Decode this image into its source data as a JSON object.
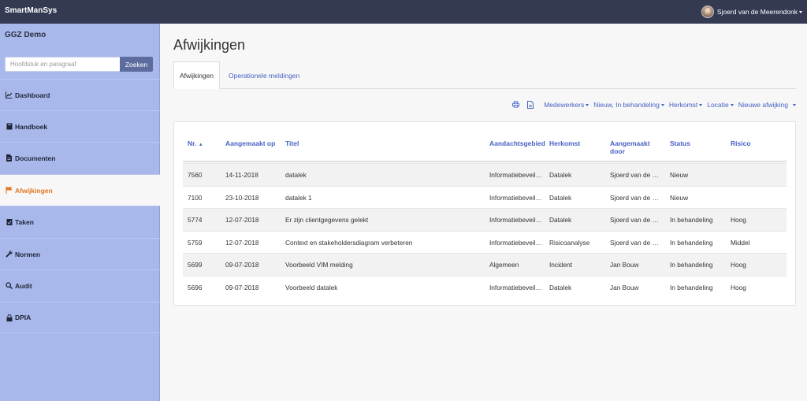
{
  "app": {
    "brand": "SmartManSys",
    "user_name": "Sjoerd van de Meerendonk"
  },
  "sidebar": {
    "org": "GGZ Demo",
    "search_placeholder": "Hoofdstuk en paragraaf",
    "search_button": "Zoeken",
    "items": [
      {
        "label": "Dashboard",
        "icon": "chart-line-icon"
      },
      {
        "label": "Handboek",
        "icon": "book-icon"
      },
      {
        "label": "Documenten",
        "icon": "file-icon"
      },
      {
        "label": "Afwijkingen",
        "icon": "flag-icon",
        "active": true
      },
      {
        "label": "Taken",
        "icon": "calendar-check-icon"
      },
      {
        "label": "Normen",
        "icon": "wrench-icon"
      },
      {
        "label": "Audit",
        "icon": "search-icon"
      },
      {
        "label": "DPIA",
        "icon": "lock-icon"
      }
    ]
  },
  "main": {
    "title": "Afwijkingen",
    "tabs": [
      {
        "label": "Afwijkingen",
        "active": true
      },
      {
        "label": "Operationele meldingen"
      }
    ],
    "toolbar": {
      "filters": [
        "Medewerkers",
        "Nieuw, In behandeling",
        "Herkomst",
        "Locatie"
      ],
      "new_label": "Nieuwe afwijking"
    }
  },
  "table": {
    "headers": [
      "Nr.",
      "Aangemaakt op",
      "Titel",
      "Aandachtsgebied",
      "Herkomst",
      "Aangemaakt door",
      "Status",
      "Risico"
    ],
    "rows": [
      [
        "7560",
        "14-11-2018",
        "datalek",
        "Informatiebeveil…",
        "Datalek",
        "Sjoerd van de …",
        "Nieuw",
        ""
      ],
      [
        "7100",
        "23-10-2018",
        "datalek 1",
        "Informatiebeveil…",
        "Datalek",
        "Sjoerd van de …",
        "Nieuw",
        ""
      ],
      [
        "5774",
        "12-07-2018",
        "Er zijn clientgegevens gelekt",
        "Informatiebeveil…",
        "Datalek",
        "Sjoerd van de …",
        "In behandeling",
        "Hoog"
      ],
      [
        "5759",
        "12-07-2018",
        "Context en stakeholdersdiagram verbeteren",
        "Informatiebeveil…",
        "Risicoanalyse",
        "Sjoerd van de …",
        "In behandeling",
        "Middel"
      ],
      [
        "5699",
        "09-07-2018",
        "Voorbeeld VIM melding",
        "Algemeen",
        "Incident",
        "Jan Bouw",
        "In behandeling",
        "Hoog"
      ],
      [
        "5696",
        "09-07-2018",
        "Voorbeeld datalek",
        "Informatiebeveil…",
        "Datalek",
        "Jan Bouw",
        "In behandeling",
        "Hoog"
      ]
    ]
  },
  "colors": {
    "topbar": "#333a52",
    "sidebar": "#a8b8ea",
    "link": "#4762c4",
    "active_nav": "#e27722",
    "button": "#5c6c9f"
  }
}
